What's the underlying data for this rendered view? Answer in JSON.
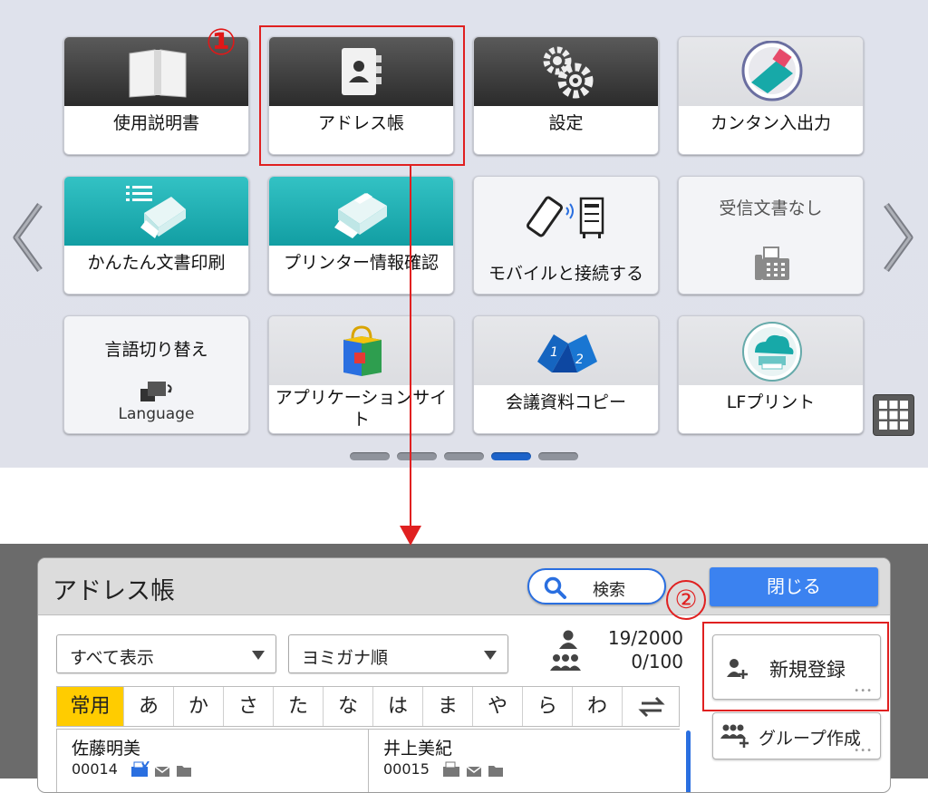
{
  "home": {
    "callout_1": "①",
    "tiles": [
      {
        "label": "使用説明書",
        "icon": "manual-book-icon"
      },
      {
        "label": "アドレス帳",
        "icon": "address-book-icon"
      },
      {
        "label": "設定",
        "icon": "gear-icon"
      },
      {
        "label": "カンタン入出力",
        "icon": "eraser-card-icon"
      },
      {
        "label": "かんたん文書印刷",
        "icon": "document-print-icon"
      },
      {
        "label": "プリンター情報確認",
        "icon": "printer-info-icon"
      },
      {
        "label": "モバイルと接続する",
        "icon": "mobile-connect-icon"
      },
      {
        "label": "受信文書なし",
        "icon": "fax-icon"
      },
      {
        "label": "言語切り替え",
        "sub": "Language",
        "icon": "language-switch-icon"
      },
      {
        "label": "アプリケーションサイト",
        "icon": "shopping-bag-icon"
      },
      {
        "label": "会議資料コピー",
        "icon": "meeting-copy-icon"
      },
      {
        "label": "LFプリント",
        "icon": "lf-print-icon"
      }
    ],
    "page_dots": 5,
    "active_page": 4,
    "colors": {
      "callout": "#e02020",
      "teal": "#129ea3",
      "accent_blue": "#1d63c9"
    }
  },
  "address_book": {
    "title": "アドレス帳",
    "search_label": "検索",
    "close_label": "閉じる",
    "callout_2": "②",
    "filter_display": "すべて表示",
    "filter_sort": "ヨミガナ順",
    "user_count": "19/2000",
    "group_count": "0/100",
    "kana_tabs": [
      "常用",
      "あ",
      "か",
      "さ",
      "た",
      "な",
      "は",
      "ま",
      "や",
      "ら",
      "わ"
    ],
    "active_tab": 0,
    "entries": [
      {
        "name": "佐藤明美",
        "number": "00014"
      },
      {
        "name": "井上美紀",
        "number": "00015"
      }
    ],
    "new_registration_label": "新規登録",
    "create_group_label": "グループ作成"
  }
}
